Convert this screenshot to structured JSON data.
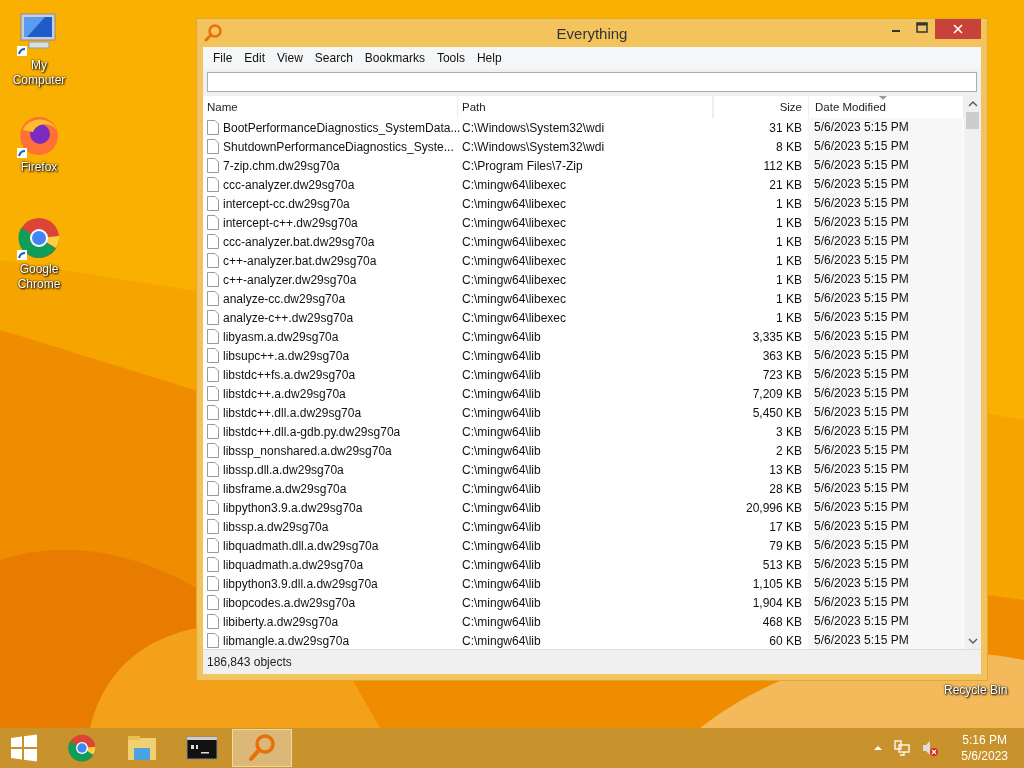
{
  "desktop_icons": [
    {
      "kind": "computer",
      "label": "My Computer"
    },
    {
      "kind": "firefox",
      "label": "Firefox"
    },
    {
      "kind": "chrome",
      "label": "Google Chrome"
    }
  ],
  "recycle_bin": {
    "label": "Recycle Bin"
  },
  "window": {
    "title": "Everything"
  },
  "menu": [
    "File",
    "Edit",
    "View",
    "Search",
    "Bookmarks",
    "Tools",
    "Help"
  ],
  "table": {
    "columns": [
      "Name",
      "Path",
      "Size",
      "Date Modified"
    ],
    "rows": [
      [
        "BootPerformanceDiagnostics_SystemData...",
        "C:\\Windows\\System32\\wdi",
        "31 KB",
        "5/6/2023 5:15 PM"
      ],
      [
        "ShutdownPerformanceDiagnostics_Syste...",
        "C:\\Windows\\System32\\wdi",
        "8 KB",
        "5/6/2023 5:15 PM"
      ],
      [
        "7-zip.chm.dw29sg70a",
        "C:\\Program Files\\7-Zip",
        "112 KB",
        "5/6/2023 5:15 PM"
      ],
      [
        "ccc-analyzer.dw29sg70a",
        "C:\\mingw64\\libexec",
        "21 KB",
        "5/6/2023 5:15 PM"
      ],
      [
        "intercept-cc.dw29sg70a",
        "C:\\mingw64\\libexec",
        "1 KB",
        "5/6/2023 5:15 PM"
      ],
      [
        "intercept-c++.dw29sg70a",
        "C:\\mingw64\\libexec",
        "1 KB",
        "5/6/2023 5:15 PM"
      ],
      [
        "ccc-analyzer.bat.dw29sg70a",
        "C:\\mingw64\\libexec",
        "1 KB",
        "5/6/2023 5:15 PM"
      ],
      [
        "c++-analyzer.bat.dw29sg70a",
        "C:\\mingw64\\libexec",
        "1 KB",
        "5/6/2023 5:15 PM"
      ],
      [
        "c++-analyzer.dw29sg70a",
        "C:\\mingw64\\libexec",
        "1 KB",
        "5/6/2023 5:15 PM"
      ],
      [
        "analyze-cc.dw29sg70a",
        "C:\\mingw64\\libexec",
        "1 KB",
        "5/6/2023 5:15 PM"
      ],
      [
        "analyze-c++.dw29sg70a",
        "C:\\mingw64\\libexec",
        "1 KB",
        "5/6/2023 5:15 PM"
      ],
      [
        "libyasm.a.dw29sg70a",
        "C:\\mingw64\\lib",
        "3,335 KB",
        "5/6/2023 5:15 PM"
      ],
      [
        "libsupc++.a.dw29sg70a",
        "C:\\mingw64\\lib",
        "363 KB",
        "5/6/2023 5:15 PM"
      ],
      [
        "libstdc++fs.a.dw29sg70a",
        "C:\\mingw64\\lib",
        "723 KB",
        "5/6/2023 5:15 PM"
      ],
      [
        "libstdc++.a.dw29sg70a",
        "C:\\mingw64\\lib",
        "7,209 KB",
        "5/6/2023 5:15 PM"
      ],
      [
        "libstdc++.dll.a.dw29sg70a",
        "C:\\mingw64\\lib",
        "5,450 KB",
        "5/6/2023 5:15 PM"
      ],
      [
        "libstdc++.dll.a-gdb.py.dw29sg70a",
        "C:\\mingw64\\lib",
        "3 KB",
        "5/6/2023 5:15 PM"
      ],
      [
        "libssp_nonshared.a.dw29sg70a",
        "C:\\mingw64\\lib",
        "2 KB",
        "5/6/2023 5:15 PM"
      ],
      [
        "libssp.dll.a.dw29sg70a",
        "C:\\mingw64\\lib",
        "13 KB",
        "5/6/2023 5:15 PM"
      ],
      [
        "libsframe.a.dw29sg70a",
        "C:\\mingw64\\lib",
        "28 KB",
        "5/6/2023 5:15 PM"
      ],
      [
        "libpython3.9.a.dw29sg70a",
        "C:\\mingw64\\lib",
        "20,996 KB",
        "5/6/2023 5:15 PM"
      ],
      [
        "libssp.a.dw29sg70a",
        "C:\\mingw64\\lib",
        "17 KB",
        "5/6/2023 5:15 PM"
      ],
      [
        "libquadmath.dll.a.dw29sg70a",
        "C:\\mingw64\\lib",
        "79 KB",
        "5/6/2023 5:15 PM"
      ],
      [
        "libquadmath.a.dw29sg70a",
        "C:\\mingw64\\lib",
        "513 KB",
        "5/6/2023 5:15 PM"
      ],
      [
        "libpython3.9.dll.a.dw29sg70a",
        "C:\\mingw64\\lib",
        "1,105 KB",
        "5/6/2023 5:15 PM"
      ],
      [
        "libopcodes.a.dw29sg70a",
        "C:\\mingw64\\lib",
        "1,904 KB",
        "5/6/2023 5:15 PM"
      ],
      [
        "libiberty.a.dw29sg70a",
        "C:\\mingw64\\lib",
        "468 KB",
        "5/6/2023 5:15 PM"
      ],
      [
        "libmangle.a.dw29sg70a",
        "C:\\mingw64\\lib",
        "60 KB",
        "5/6/2023 5:15 PM"
      ]
    ]
  },
  "status_bar": "186,843 objects",
  "taskbar": {
    "apps": [
      {
        "kind": "chrome",
        "selected": false
      },
      {
        "kind": "explorer",
        "selected": false
      },
      {
        "kind": "terminal",
        "selected": false
      },
      {
        "kind": "search",
        "selected": true
      }
    ],
    "clock": {
      "time": "5:16 PM",
      "date": "5/6/2023"
    }
  }
}
